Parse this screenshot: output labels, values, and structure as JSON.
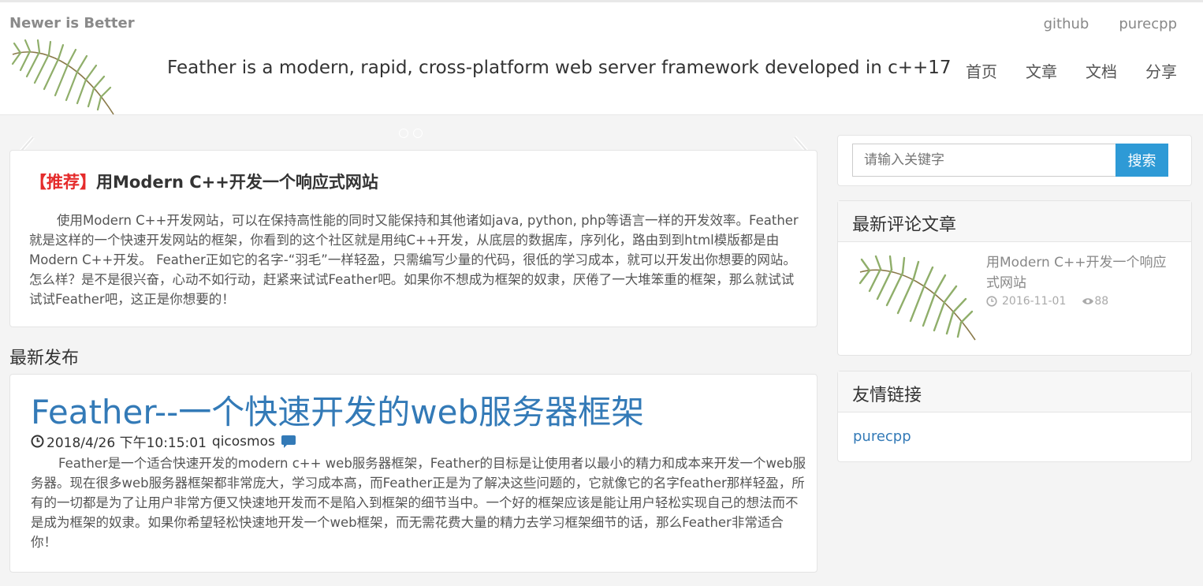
{
  "header": {
    "brand": "Newer is Better",
    "tagline": "Feather is a modern, rapid, cross-platform web server framework developed in c++17",
    "top_links": [
      "github",
      "purecpp"
    ],
    "nav": [
      "首页",
      "文章",
      "文档",
      "分享"
    ]
  },
  "featured": {
    "tag": "【推荐】",
    "title": "用Modern C++开发一个响应式网站",
    "body": "使用Modern C++开发网站，可以在保持高性能的同时又能保持和其他诸如java, python, php等语言一样的开发效率。Feather就是这样的一个快速开发网站的框架，你看到的这个社区就是用纯C++开发，从底层的数据库，序列化，路由到到html模版都是由Modern C++开发。 Feather正如它的名字-“羽毛”一样轻盈，只需编写少量的代码，很低的学习成本，就可以开发出你想要的网站。怎么样？是不是很兴奋，心动不如行动，赶紧来试试Feather吧。如果你不想成为框架的奴隶，厌倦了一大堆笨重的框架，那么就试试试试Feather吧，这正是你想要的！"
  },
  "latest": {
    "section_title": "最新发布",
    "post": {
      "title": "Feather--一个快速开发的web服务器框架",
      "date": "2018/4/26 下午10:15:01",
      "author": "qicosmos",
      "body": "Feather是一个适合快速开发的modern c++ web服务器框架，Feather的目标是让使用者以最小的精力和成本来开发一个web服务器。现在很多web服务器框架都非常庞大，学习成本高，而Feather正是为了解决这些问题的，它就像它的名字feather那样轻盈，所有的一切都是为了让用户非常方便又快速地开发而不是陷入到框架的细节当中。一个好的框架应该是能让用户轻松实现自己的想法而不是成为框架的奴隶。如果你希望轻松快速地开发一个web框架，而无需花费大量的精力去学习框架细节的话，那么Feather非常适合你！"
    }
  },
  "sidebar": {
    "search": {
      "placeholder": "请输入关键字",
      "button": "搜索"
    },
    "recent": {
      "title": "最新评论文章",
      "items": [
        {
          "title": "用Modern C++开发一个响应式网站",
          "date": "2016-11-01",
          "views": "88"
        }
      ]
    },
    "links": {
      "title": "友情链接",
      "items": [
        "purecpp"
      ]
    }
  },
  "colors": {
    "accent": "#337ab7",
    "button": "#2e9ad6",
    "tag": "#e52b2b"
  }
}
